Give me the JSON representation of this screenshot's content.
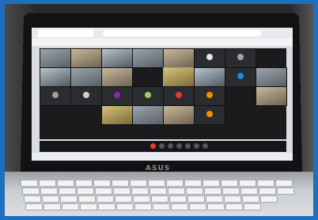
{
  "laptop": {
    "brand_label": "ASUS"
  },
  "meeting": {
    "participants": [
      {
        "name": "",
        "type": "camera"
      },
      {
        "name": "",
        "type": "camera"
      },
      {
        "name": "",
        "type": "camera"
      },
      {
        "name": "",
        "type": "camera"
      },
      {
        "name": "",
        "type": "camera"
      },
      {
        "name": "",
        "type": "avatar",
        "color": "#e6e6e6"
      },
      {
        "name": "",
        "type": "avatar",
        "color": "#a3a3a3"
      },
      {
        "name": "",
        "type": "camera"
      },
      {
        "name": "",
        "type": "camera"
      },
      {
        "name": "",
        "type": "camera"
      },
      {
        "name": "",
        "type": "camera"
      },
      {
        "name": "",
        "type": "camera"
      },
      {
        "name": "",
        "type": "avatar",
        "color": "#1e88e5"
      },
      {
        "name": "",
        "type": "camera"
      },
      {
        "name": "",
        "type": "avatar",
        "color": "#9e9e9e"
      },
      {
        "name": "",
        "type": "avatar",
        "color": "#cfcfcf"
      },
      {
        "name": "",
        "type": "avatar",
        "color": "#8e24aa"
      },
      {
        "name": "",
        "type": "avatar",
        "color": "#9ccc65"
      },
      {
        "name": "",
        "type": "avatar",
        "color": "#e53935"
      },
      {
        "name": "",
        "type": "avatar",
        "color": "#fb8c00"
      },
      {
        "name": "",
        "type": "camera"
      },
      {
        "name": "",
        "type": "camera"
      },
      {
        "name": "",
        "type": "camera"
      },
      {
        "name": "",
        "type": "camera"
      },
      {
        "name": "",
        "type": "avatar",
        "color": "#fb8c00"
      }
    ],
    "end_button_color": "#e53935"
  }
}
